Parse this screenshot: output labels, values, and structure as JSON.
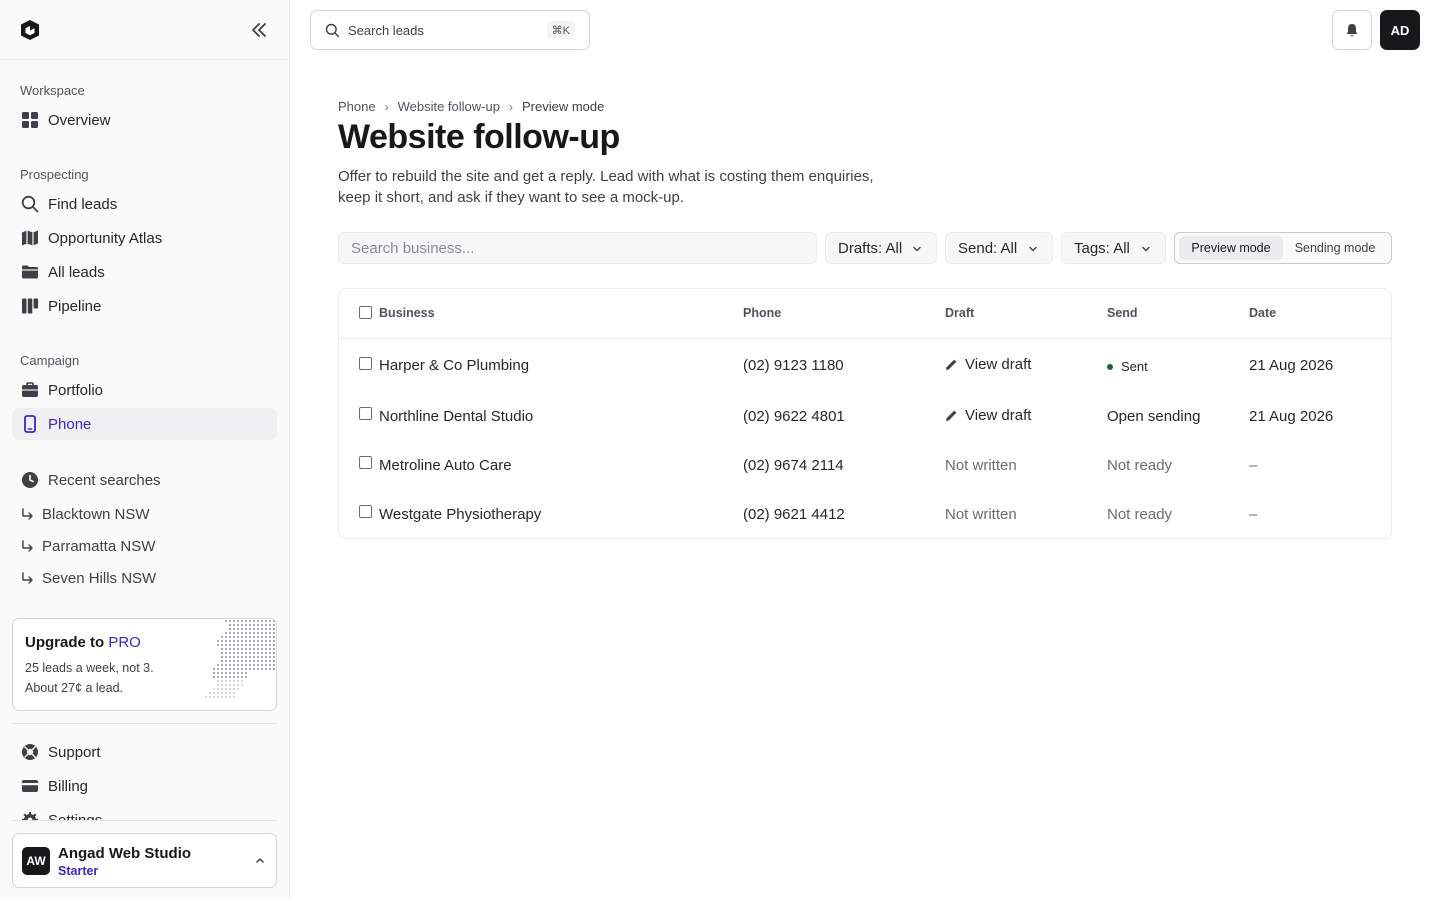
{
  "sidebar": {
    "sections": {
      "workspace": "Workspace",
      "prospecting": "Prospecting",
      "campaign": "Campaign"
    },
    "items": {
      "overview": "Overview",
      "find_leads": "Find leads",
      "opportunity_atlas": "Opportunity Atlas",
      "all_leads": "All leads",
      "pipeline": "Pipeline",
      "portfolio": "Portfolio",
      "phone": "Phone",
      "recent_searches": "Recent searches",
      "support": "Support",
      "billing": "Billing",
      "settings": "Settings"
    },
    "recent": [
      "Blacktown NSW",
      "Parramatta NSW",
      "Seven Hills NSW"
    ],
    "upgrade": {
      "title_prefix": "Upgrade to",
      "title_pro": "PRO",
      "line1": "25 leads a week, not 3.",
      "line2": "About 27¢ a lead."
    },
    "account": {
      "initials": "AW",
      "name": "Angad Web Studio",
      "plan": "Starter"
    }
  },
  "topbar": {
    "search_label": "Search leads",
    "shortcut": "⌘K",
    "user_initials": "AD"
  },
  "page": {
    "breadcrumb": [
      "Phone",
      "Website follow-up",
      "Preview mode"
    ],
    "title": "Website follow-up",
    "description": "Offer to rebuild the site and get a reply. Lead with what is costing them enquiries, keep it short, and ask if they want to see a mock-up."
  },
  "filters": {
    "search_placeholder": "Search business...",
    "drafts": "Drafts: All",
    "send": "Send: All",
    "tags": "Tags: All",
    "mode_preview": "Preview mode",
    "mode_sending": "Sending mode"
  },
  "table": {
    "headers": {
      "business": "Business",
      "phone": "Phone",
      "draft": "Draft",
      "send": "Send",
      "date": "Date"
    },
    "rows": [
      {
        "business": "Harper & Co Plumbing",
        "phone": "(02) 9123 1180",
        "draft": "View draft",
        "send": "Sent",
        "date": "21 Aug 2026"
      },
      {
        "business": "Northline Dental Studio",
        "phone": "(02) 9622 4801",
        "draft": "View draft",
        "send": "Open sending",
        "date": "21 Aug 2026"
      },
      {
        "business": "Metroline Auto Care",
        "phone": "(02) 9674 2114",
        "draft": "Not written",
        "send": "Not ready",
        "date": "–"
      },
      {
        "business": "Westgate Physiotherapy",
        "phone": "(02) 9621 4412",
        "draft": "Not written",
        "send": "Not ready",
        "date": "–"
      }
    ]
  },
  "colors": {
    "accent": "#3b28c4",
    "sent_dot": "#166534",
    "dark": "#18181b"
  }
}
